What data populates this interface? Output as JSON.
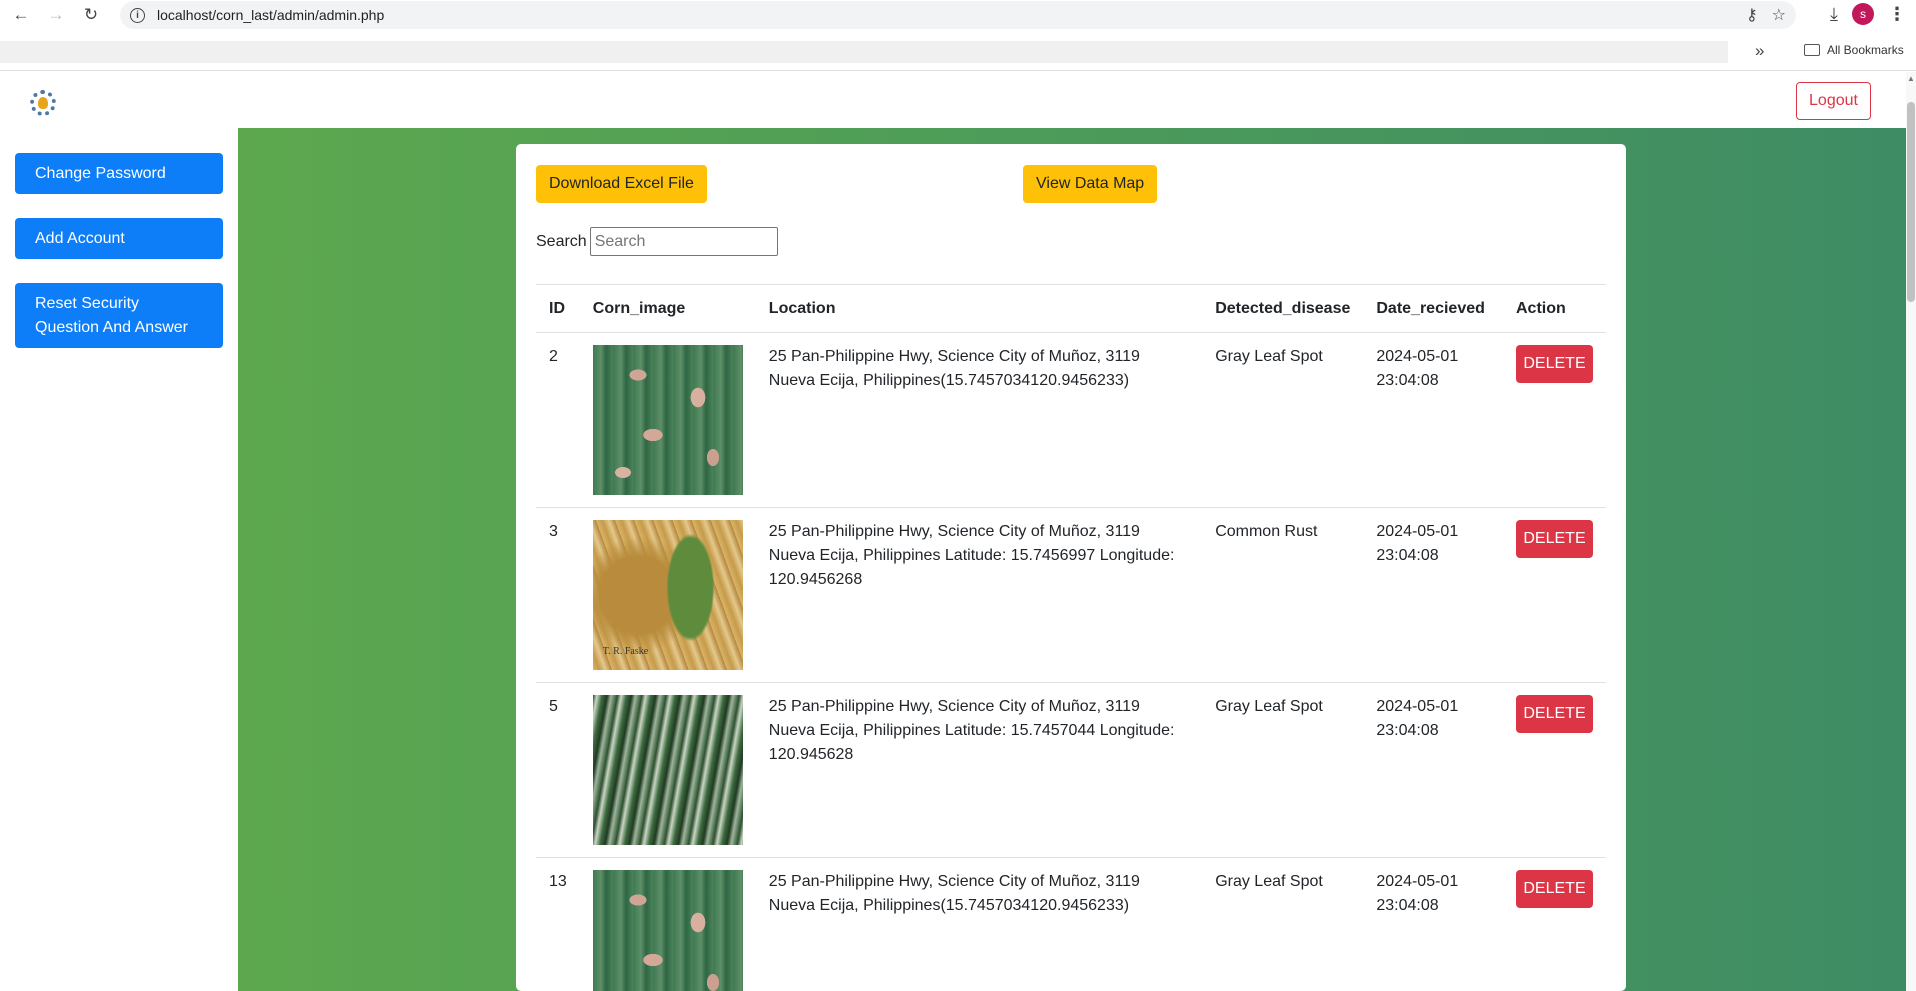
{
  "browser": {
    "url": "localhost/corn_last/admin/admin.php",
    "profile_initial": "s",
    "all_bookmarks_label": "All Bookmarks"
  },
  "header": {
    "logout_label": "Logout"
  },
  "sidebar": {
    "items": [
      {
        "label": "Change Password"
      },
      {
        "label": "Add Account"
      },
      {
        "label": "Reset Security Question And Answer"
      }
    ]
  },
  "toolbar": {
    "download_label": "Download Excel File",
    "view_map_label": "View Data Map"
  },
  "search": {
    "label": "Search",
    "placeholder": "Search",
    "value": ""
  },
  "table": {
    "columns": [
      "ID",
      "Corn_image",
      "Location",
      "Detected_disease",
      "Date_recieved",
      "Action"
    ],
    "rows": [
      {
        "id": "2",
        "image": "gray-leaf-spot-leaf",
        "location": "25 Pan-Philippine Hwy, Science City of Muñoz, 3119 Nueva Ecija, Philippines(15.7457034120.9456233)",
        "disease": "Gray Leaf Spot",
        "date": "2024-05-01",
        "time": "23:04:08",
        "action": "DELETE"
      },
      {
        "id": "3",
        "image": "common-rust-leaf",
        "image_credit": "T. R. Faske",
        "location": "25 Pan-Philippine Hwy, Science City of Muñoz, 3119 Nueva Ecija, Philippines Latitude: 15.7456997 Longitude: 120.9456268",
        "disease": "Common Rust",
        "date": "2024-05-01",
        "time": "23:04:08",
        "action": "DELETE"
      },
      {
        "id": "5",
        "image": "gray-leaf-spot-field",
        "location": "25 Pan-Philippine Hwy, Science City of Muñoz, 3119 Nueva Ecija, Philippines Latitude: 15.7457044 Longitude: 120.945628",
        "disease": "Gray Leaf Spot",
        "date": "2024-05-01",
        "time": "23:04:08",
        "action": "DELETE"
      },
      {
        "id": "13",
        "image": "gray-leaf-spot-leaf",
        "location": "25 Pan-Philippine Hwy, Science City of Muñoz, 3119 Nueva Ecija, Philippines(15.7457034120.9456233)",
        "disease": "Gray Leaf Spot",
        "date": "2024-05-01",
        "time": "23:04:08",
        "action": "DELETE"
      }
    ]
  },
  "colors": {
    "primary": "#0d7df8",
    "warning": "#ffc107",
    "danger": "#dc3545",
    "content_bg_start": "#5da84e",
    "content_bg_end": "#3e8c64"
  }
}
